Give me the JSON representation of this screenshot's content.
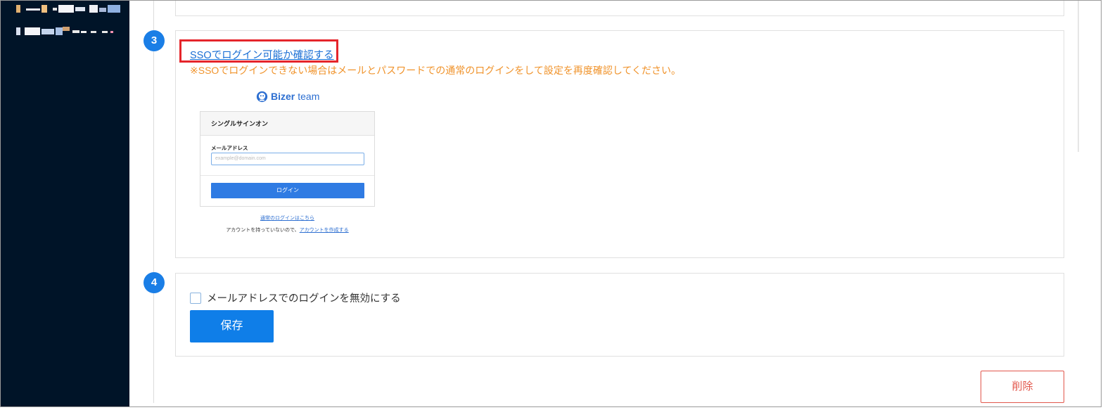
{
  "colors": {
    "sidebar_bg": "#001428",
    "accent_blue": "#1a7ee6",
    "highlight_red": "#e5252b",
    "note_orange": "#f0932b",
    "danger": "#e2574c"
  },
  "steps": {
    "step3": {
      "number": "3",
      "sso_link": "SSOでログイン可能か確認する",
      "note": "※SSOでログインできない場合はメールとパスワードでの通常のログインをして設定を再度確認してください。",
      "preview": {
        "brand_logo": "bizer-logo-icon",
        "brand_name": "Bizer",
        "brand_suffix": "team",
        "card_title": "シングルサインオン",
        "email_label": "メールアドレス",
        "email_placeholder": "example@domain.com",
        "login_button": "ログイン",
        "normal_login_link": "通常のログインはこちら",
        "no_account_text": "アカウントを持っていないので、",
        "create_account_link": "アカウントを作成する"
      }
    },
    "step4": {
      "number": "4",
      "checkbox_label": "メールアドレスでのログインを無効にする",
      "checkbox_checked": false,
      "save_button": "保存"
    }
  },
  "delete_button": "削除"
}
